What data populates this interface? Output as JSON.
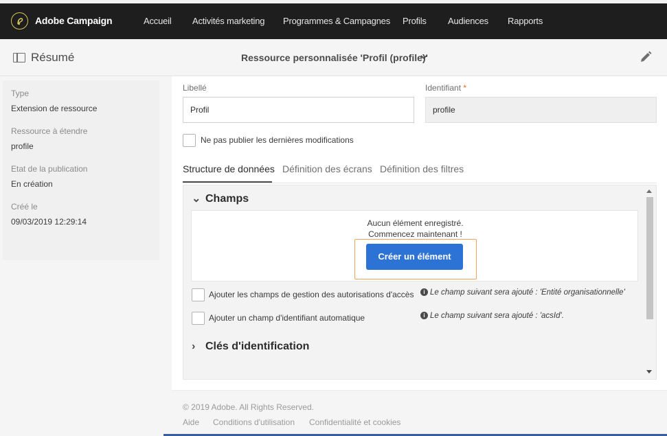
{
  "app": {
    "title": "Adobe Campaign"
  },
  "nav": {
    "items": [
      "Accueil",
      "Activités marketing",
      "Programmes & Campagnes",
      "Profils",
      "Audiences",
      "Rapports"
    ]
  },
  "header": {
    "summary_label": "Résumé",
    "title": "Ressource personnalisée 'Profil (profile)'"
  },
  "summary": {
    "type_label": "Type",
    "type_value": "Extension de ressource",
    "resource_label": "Ressource à étendre",
    "resource_value": "profile",
    "status_label": "Etat de la publication",
    "status_value": "En création",
    "created_label": "Créé le",
    "created_value": "09/03/2019 12:29:14"
  },
  "form": {
    "label_field_label": "Libellé",
    "label_field_value": "Profil",
    "id_field_label": "Identifiant",
    "id_required": "*",
    "id_field_value": "profile",
    "no_publish_label": "Ne pas publier les dernières modifications"
  },
  "tabs": [
    "Structure de données",
    "Définition des écrans",
    "Définition des filtres"
  ],
  "fields_section": {
    "title": "Champs",
    "empty_line1": "Aucun élément enregistré.",
    "empty_line2": "Commencez maintenant !",
    "create_button": "Créer un élément",
    "access_checkbox_label": "Ajouter les champs de gestion des autorisations d'accès",
    "access_info": "Le champ suivant sera ajouté : 'Entité organisationnelle'",
    "autoid_checkbox_label": "Ajouter un champ d'identifiant automatique",
    "autoid_info": "Le champ suivant sera ajouté : 'acsId'."
  },
  "keys_section": {
    "title": "Clés d'identification"
  },
  "footer": {
    "copyright": "© 2019 Adobe. All Rights Reserved.",
    "links": [
      "Aide",
      "Conditions d'utilisation",
      "Confidentialité et cookies"
    ]
  },
  "colors": {
    "nav_bg": "#1e1e1e",
    "primary_button": "#2d73d6",
    "highlight": "#f0a35c",
    "required": "#e56a1f"
  }
}
